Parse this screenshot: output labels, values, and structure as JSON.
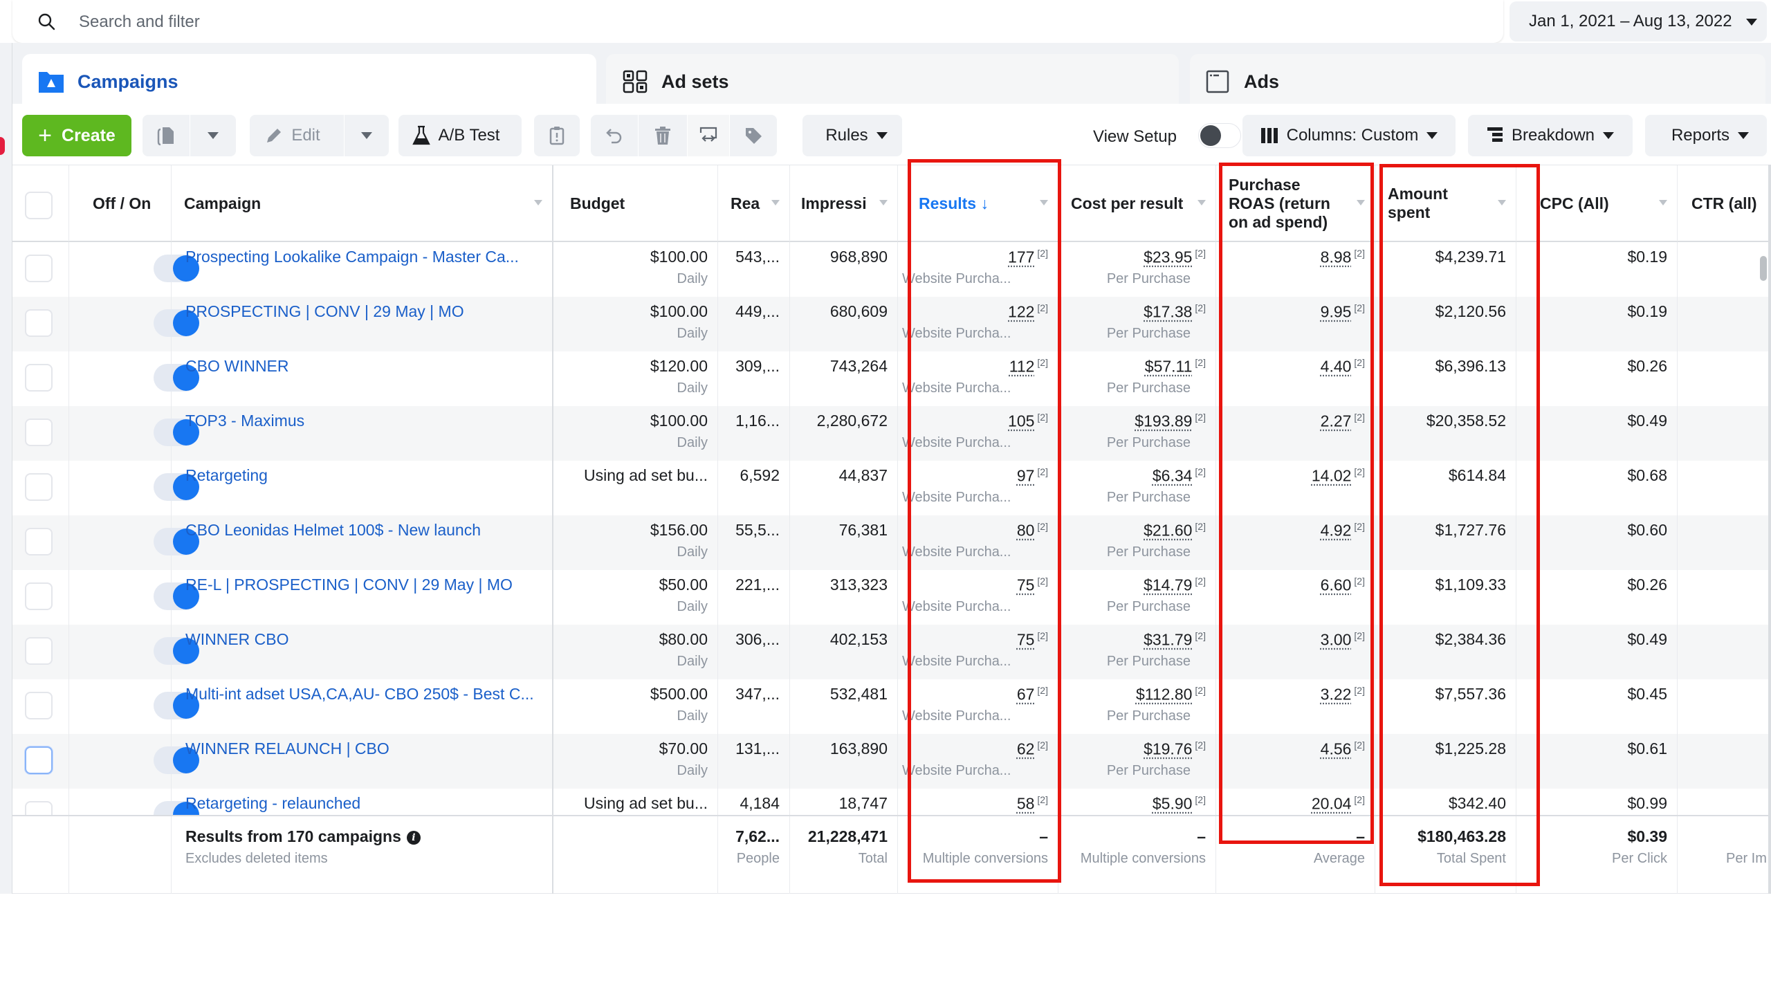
{
  "search": {
    "placeholder": "Search and filter"
  },
  "date_range": "Jan 1, 2021 – Aug 13, 2022",
  "tabs": [
    {
      "label": "Campaigns",
      "icon": "folder-flag-icon",
      "active": true
    },
    {
      "label": "Ad sets",
      "icon": "grid-icon",
      "active": false
    },
    {
      "label": "Ads",
      "icon": "ad-window-icon",
      "active": false
    }
  ],
  "toolbar": {
    "create_label": "Create",
    "edit_label": "Edit",
    "abtest_label": "A/B Test",
    "rules_label": "Rules",
    "view_setup_label": "View Setup",
    "view_setup_on": false,
    "columns_label": "Columns: Custom",
    "breakdown_label": "Breakdown",
    "reports_label": "Reports"
  },
  "columns": {
    "off_on": "Off / On",
    "campaign": "Campaign",
    "budget": "Budget",
    "reach": "Rea",
    "impressions": "Impressi",
    "results": "Results ↓",
    "cost_per_result": "Cost per result",
    "roas": "Purchase ROAS (return on ad spend)",
    "amount_spent": "Amount spent",
    "cpc": "CPC (All)",
    "ctr": "CTR (all)"
  },
  "rows": [
    {
      "campaign": "Prospecting Lookalike Campaign - Master Ca...",
      "budget": "$100.00",
      "budget_sub": "Daily",
      "reach": "543,...",
      "impressions": "968,890",
      "results": "177",
      "results_sub": "Website Purcha...",
      "cost": "$23.95",
      "cost_sub": "Per Purchase",
      "roas": "8.98",
      "spent": "$4,239.71",
      "cpc": "$0.19",
      "on": true
    },
    {
      "campaign": "PROSPECTING | CONV | 29 May | MO",
      "budget": "$100.00",
      "budget_sub": "Daily",
      "reach": "449,...",
      "impressions": "680,609",
      "results": "122",
      "results_sub": "Website Purcha...",
      "cost": "$17.38",
      "cost_sub": "Per Purchase",
      "roas": "9.95",
      "spent": "$2,120.56",
      "cpc": "$0.19",
      "on": true
    },
    {
      "campaign": "CBO WINNER",
      "budget": "$120.00",
      "budget_sub": "Daily",
      "reach": "309,...",
      "impressions": "743,264",
      "results": "112",
      "results_sub": "Website Purcha...",
      "cost": "$57.11",
      "cost_sub": "Per Purchase",
      "roas": "4.40",
      "spent": "$6,396.13",
      "cpc": "$0.26",
      "on": true
    },
    {
      "campaign": "TOP3 - Maximus",
      "budget": "$100.00",
      "budget_sub": "Daily",
      "reach": "1,16...",
      "impressions": "2,280,672",
      "results": "105",
      "results_sub": "Website Purcha...",
      "cost": "$193.89",
      "cost_sub": "Per Purchase",
      "roas": "2.27",
      "spent": "$20,358.52",
      "cpc": "$0.49",
      "on": true
    },
    {
      "campaign": "Retargeting",
      "budget": "Using ad set bu...",
      "budget_sub": "",
      "reach": "6,592",
      "impressions": "44,837",
      "results": "97",
      "results_sub": "Website Purcha...",
      "cost": "$6.34",
      "cost_sub": "Per Purchase",
      "roas": "14.02",
      "spent": "$614.84",
      "cpc": "$0.68",
      "on": true
    },
    {
      "campaign": "CBO Leonidas Helmet 100$ - New launch",
      "budget": "$156.00",
      "budget_sub": "Daily",
      "reach": "55,5...",
      "impressions": "76,381",
      "results": "80",
      "results_sub": "Website Purcha...",
      "cost": "$21.60",
      "cost_sub": "Per Purchase",
      "roas": "4.92",
      "spent": "$1,727.76",
      "cpc": "$0.60",
      "on": true
    },
    {
      "campaign": "RE-L | PROSPECTING | CONV | 29 May | MO",
      "budget": "$50.00",
      "budget_sub": "Daily",
      "reach": "221,...",
      "impressions": "313,323",
      "results": "75",
      "results_sub": "Website Purcha...",
      "cost": "$14.79",
      "cost_sub": "Per Purchase",
      "roas": "6.60",
      "spent": "$1,109.33",
      "cpc": "$0.26",
      "on": true
    },
    {
      "campaign": "WINNER CBO",
      "budget": "$80.00",
      "budget_sub": "Daily",
      "reach": "306,...",
      "impressions": "402,153",
      "results": "75",
      "results_sub": "Website Purcha...",
      "cost": "$31.79",
      "cost_sub": "Per Purchase",
      "roas": "3.00",
      "spent": "$2,384.36",
      "cpc": "$0.49",
      "on": true
    },
    {
      "campaign": "Multi-int adset USA,CA,AU- CBO 250$ - Best C...",
      "budget": "$500.00",
      "budget_sub": "Daily",
      "reach": "347,...",
      "impressions": "532,481",
      "results": "67",
      "results_sub": "Website Purcha...",
      "cost": "$112.80",
      "cost_sub": "Per Purchase",
      "roas": "3.22",
      "spent": "$7,557.36",
      "cpc": "$0.45",
      "on": true
    },
    {
      "campaign": "WINNER RELAUNCH | CBO",
      "budget": "$70.00",
      "budget_sub": "Daily",
      "reach": "131,...",
      "impressions": "163,890",
      "results": "62",
      "results_sub": "Website Purcha...",
      "cost": "$19.76",
      "cost_sub": "Per Purchase",
      "roas": "4.56",
      "spent": "$1,225.28",
      "cpc": "$0.61",
      "on": true
    },
    {
      "campaign": "Retargeting - relaunched",
      "budget": "Using ad set bu...",
      "budget_sub": "",
      "reach": "4,184",
      "impressions": "18,747",
      "results": "58",
      "results_sub": "",
      "cost": "$5.90",
      "cost_sub": "",
      "roas": "20.04",
      "spent": "$342.40",
      "cpc": "$0.99",
      "on": true
    }
  ],
  "ref_marker": "[2]",
  "summary": {
    "title": "Results from 170 campaigns",
    "subtitle": "Excludes deleted items",
    "reach": "7,62...",
    "reach_sub": "People",
    "impressions": "21,228,471",
    "impressions_sub": "Total",
    "results": "–",
    "results_sub": "Multiple conversions",
    "cost": "–",
    "cost_sub": "Multiple conversions",
    "roas": "–",
    "roas_sub": "Average",
    "spent": "$180,463.28",
    "spent_sub": "Total Spent",
    "cpc": "$0.39",
    "cpc_sub": "Per Click",
    "ctr_sub": "Per Im"
  },
  "colors": {
    "accent_blue": "#1877f2",
    "link_blue": "#1a5fc9",
    "create_green": "#5eb820",
    "highlight_red": "#e8150f"
  }
}
